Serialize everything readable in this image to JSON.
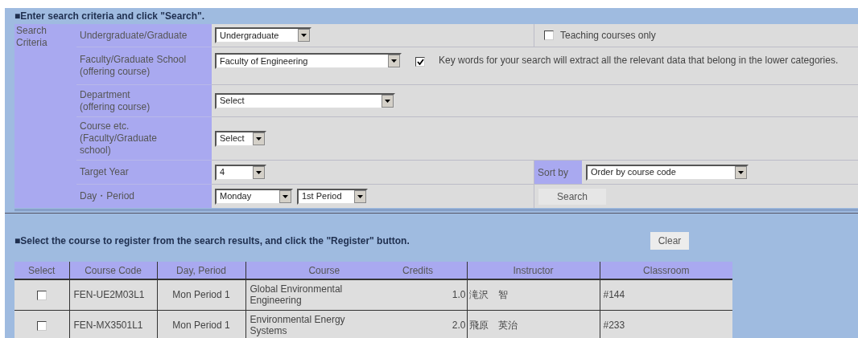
{
  "search_section": {
    "title": "■Enter search criteria and click \"Search\".",
    "criteria_label": "Search Criteria",
    "level": {
      "label": [
        "Undergraduate/Graduate"
      ],
      "value": "Undergraduate"
    },
    "teaching_only": {
      "label": "Teaching courses only",
      "checked": false
    },
    "faculty": {
      "label": [
        "Faculty/Graduate School",
        "(offering course)"
      ],
      "value": "Faculty of Engineering"
    },
    "keyword_option": {
      "label": "Key words for your search will extract all the relevant data that belong in the lower categories.",
      "checked": true
    },
    "department": {
      "label": [
        "Department",
        "(offering course)"
      ],
      "value": "Select"
    },
    "course": {
      "label": [
        "Course etc.",
        "(Faculty/Graduate",
        "school)"
      ],
      "value": "Select"
    },
    "target_year": {
      "label": [
        "Target Year"
      ],
      "value": "4"
    },
    "sort_by": {
      "label": "Sort by",
      "value": "Order by course code"
    },
    "day_period": {
      "label": [
        "Day・Period"
      ],
      "day": "Monday",
      "period": "1st Period"
    },
    "search_button": "Search"
  },
  "results_section": {
    "title": "■Select the course to register from the search results, and click the \"Register\" button.",
    "clear_button": "Clear",
    "columns": [
      "Select",
      "Course Code",
      "Day, Period",
      "Course",
      "Credits",
      "Instructor",
      "Classroom"
    ],
    "rows": [
      {
        "selected": false,
        "code": "FEN-UE2M03L1",
        "day_period": "Mon Period 1",
        "course": "Global Environmental Engineering",
        "credits": "1.0",
        "instructor": "滝沢　智",
        "classroom": "#144"
      },
      {
        "selected": false,
        "code": "FEN-MX3501L1",
        "day_period": "Mon Period 1",
        "course": "Environmental Energy Systems",
        "credits": "2.0",
        "instructor": "飛原　英治",
        "classroom": "#233"
      }
    ]
  }
}
